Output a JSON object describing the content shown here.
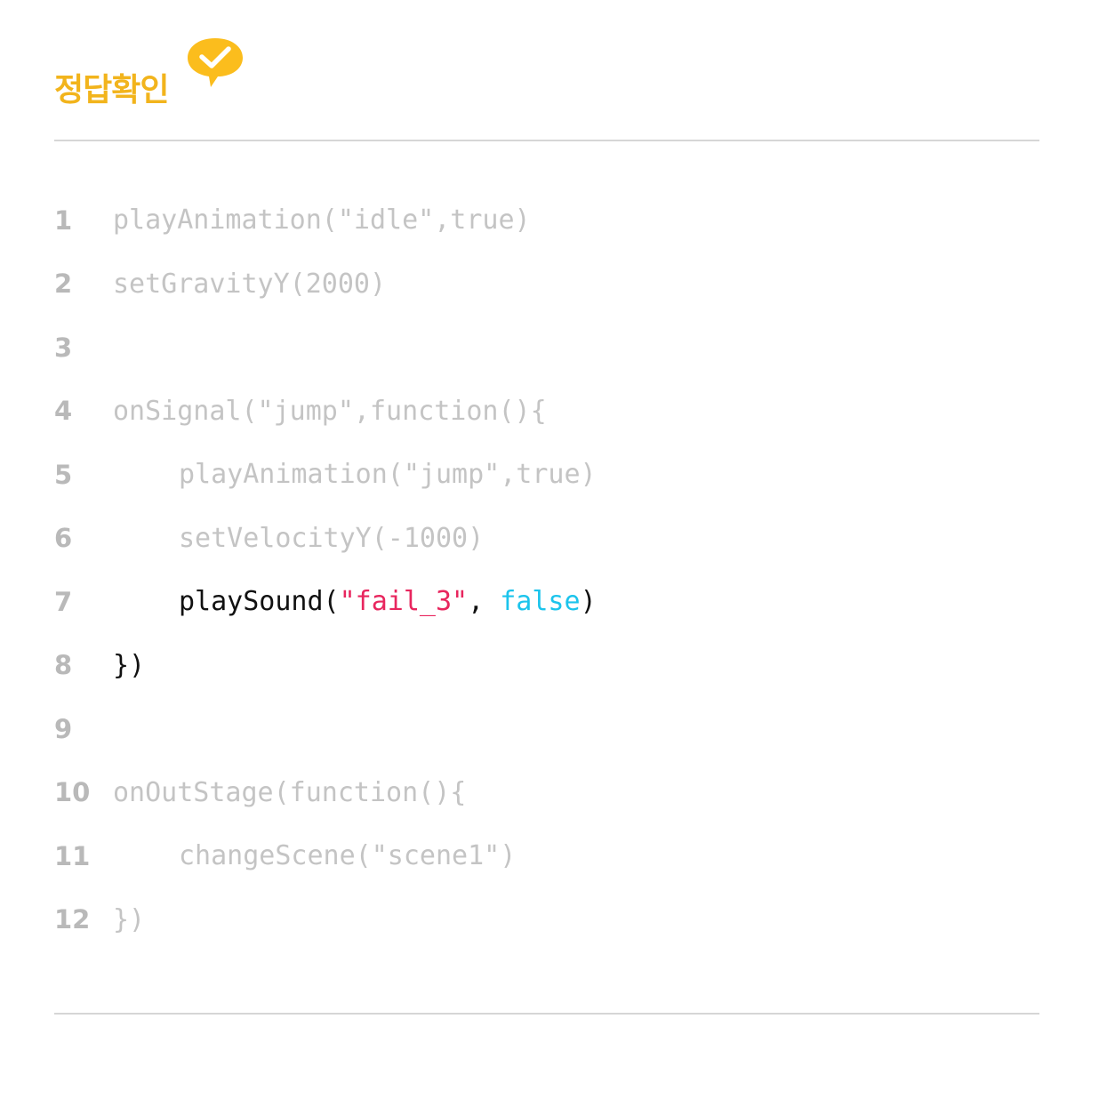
{
  "header": {
    "title": "정답확인",
    "bubble_icon": "check-speech-bubble-icon",
    "accent_color": "#f2b41c"
  },
  "code": {
    "lines": [
      {
        "number": "1",
        "text": "playAnimation(\"idle\",true)"
      },
      {
        "number": "2",
        "text": "setGravityY(2000)"
      },
      {
        "number": "3",
        "text": ""
      },
      {
        "number": "4",
        "text": "onSignal(\"jump\",function(){"
      },
      {
        "number": "5",
        "text": "playAnimation(\"jump\",true)"
      },
      {
        "number": "6",
        "text": "setVelocityY(-1000)"
      },
      {
        "number": "7",
        "call": "playSound(",
        "string": "\"fail_3\"",
        "comma": ", ",
        "keyword": "false",
        "close": ")"
      },
      {
        "number": "8",
        "text": "})"
      },
      {
        "number": "9",
        "text": ""
      },
      {
        "number": "10",
        "text": "onOutStage(function(){"
      },
      {
        "number": "11",
        "text": "changeScene(\"scene1\")"
      },
      {
        "number": "12",
        "text": "})"
      }
    ]
  },
  "colors": {
    "dimmed_code": "#c4c4c4",
    "active_code": "#111111",
    "string": "#e8265e",
    "keyword": "#1cc4ec",
    "line_number": "#b9b9b9",
    "divider": "#d6d6d6"
  }
}
